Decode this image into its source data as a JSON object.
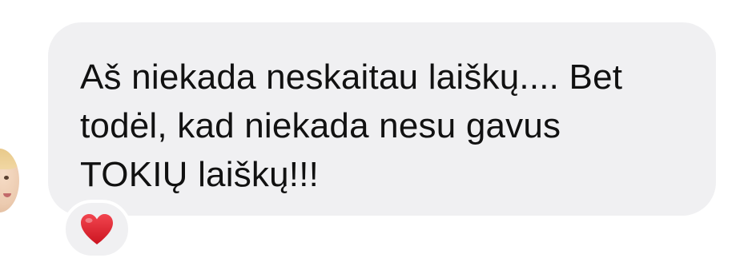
{
  "message": {
    "lines": [
      "Aš niekada neskaitau laiškų.... Bet",
      "todėl, kad niekada nesu gavus",
      "TOKIŲ laiškų!!!"
    ],
    "bubble_color": "#f0f0f2",
    "text_color": "#111111"
  },
  "reaction": {
    "icon": "red-heart-icon",
    "color": "#e0202c"
  },
  "sender": {
    "avatar_icon": "baby-avatar"
  }
}
